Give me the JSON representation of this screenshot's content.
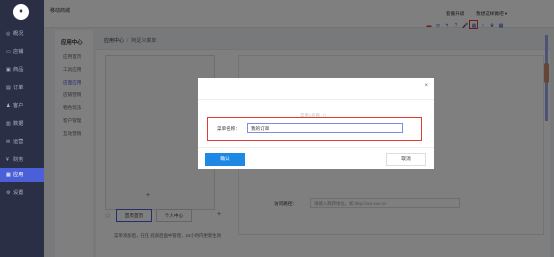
{
  "sidebar": {
    "logo": "♦",
    "items": [
      {
        "icon": "◎",
        "label": "概况"
      },
      {
        "icon": "▭",
        "label": "店铺"
      },
      {
        "icon": "▣",
        "label": "商品"
      },
      {
        "icon": "▤",
        "label": "订单"
      },
      {
        "icon": "♟",
        "label": "客户"
      },
      {
        "icon": "▥",
        "label": "数据"
      },
      {
        "icon": "✉",
        "label": "运营"
      },
      {
        "icon": "¥",
        "label": "财务"
      },
      {
        "icon": "▦",
        "label": "应用"
      },
      {
        "icon": "⚙",
        "label": "设置"
      }
    ]
  },
  "topbar": {
    "store_name": "移动商城",
    "upgrade": "套餐升级",
    "user": "我想这样做吧 ▾"
  },
  "toolbar_icons": [
    "▬",
    "⬭",
    "↰",
    "?",
    "🎤",
    "▦",
    "♀",
    "♛",
    "▦"
  ],
  "subnav": {
    "title": "应用中心",
    "items": [
      "应用首页",
      "工具应用",
      "店面应用",
      "店铺营销",
      "物色玩法",
      "客户管理",
      "互动营销"
    ]
  },
  "breadcrumb": {
    "root": "应用中心",
    "current": "阿足义菜单"
  },
  "editor": {
    "tabs": [
      "首页首页",
      "个人中心"
    ],
    "plus": "+",
    "star": "☆",
    "hint": "菜单添加后，在任 底部后面中管理，24小时内更新生效",
    "prop_label": "访问路径：",
    "prop_placeholder": "请输入跳转地址，如 http://xxx.xxx.cn"
  },
  "modal": {
    "close": "×",
    "faded_label": "菜单1名称（）",
    "field_label": "菜单名称：",
    "field_value": "我的订单",
    "ok": "确认",
    "cancel": "取消"
  }
}
